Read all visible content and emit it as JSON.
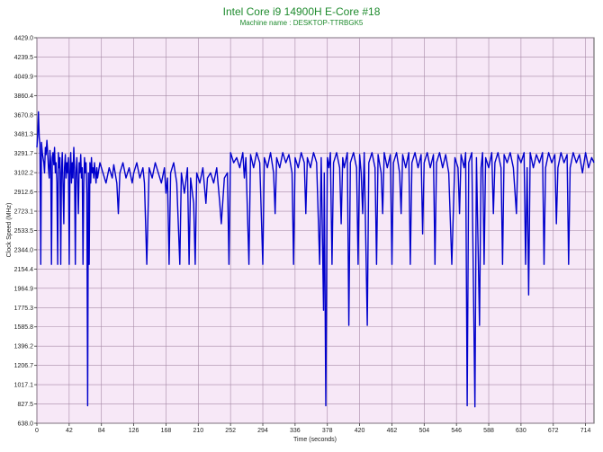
{
  "chart_data": {
    "type": "line",
    "title": "Intel Core i9 14900H E-Core #18",
    "subtitle": "Machine name : DESKTOP-TTRBGK5",
    "xlabel": "Time (seconds)",
    "ylabel": "Clock Speed (MHz)",
    "xlim": [
      0,
      725
    ],
    "ylim": [
      638.0,
      4429.0
    ],
    "x_ticks": [
      0,
      42,
      84,
      126,
      168,
      210,
      252,
      294,
      336,
      378,
      420,
      462,
      504,
      546,
      588,
      630,
      672,
      714
    ],
    "y_ticks": [
      638.0,
      827.5,
      1017.1,
      1206.7,
      1396.2,
      1585.8,
      1775.3,
      1964.9,
      2154.4,
      2344.0,
      2533.5,
      2723.1,
      2912.6,
      3102.2,
      3291.7,
      3481.3,
      3670.8,
      3860.4,
      4049.9,
      4239.5,
      4429.0
    ],
    "grid": true,
    "colors": {
      "plot_background": "#f7e8f7",
      "grid": "#a78aa7",
      "series": "#0000cc",
      "title": "#1f8b2e"
    },
    "series": [
      {
        "points": [
          [
            0,
            3350
          ],
          [
            1,
            3480
          ],
          [
            2,
            3700
          ],
          [
            3,
            3450
          ],
          [
            4,
            3380
          ],
          [
            5,
            2200
          ],
          [
            6,
            3400
          ],
          [
            7,
            3300
          ],
          [
            8,
            3250
          ],
          [
            9,
            3200
          ],
          [
            10,
            3100
          ],
          [
            11,
            3350
          ],
          [
            12,
            3280
          ],
          [
            13,
            3420
          ],
          [
            14,
            3300
          ],
          [
            15,
            3150
          ],
          [
            16,
            3050
          ],
          [
            17,
            3320
          ],
          [
            18,
            3200
          ],
          [
            19,
            2200
          ],
          [
            20,
            3250
          ],
          [
            21,
            3300
          ],
          [
            22,
            3180
          ],
          [
            23,
            3350
          ],
          [
            24,
            3100
          ],
          [
            25,
            3200
          ],
          [
            26,
            3000
          ],
          [
            27,
            2200
          ],
          [
            28,
            3300
          ],
          [
            29,
            3150
          ],
          [
            30,
            3250
          ],
          [
            31,
            2200
          ],
          [
            32,
            3100
          ],
          [
            33,
            3300
          ],
          [
            34,
            3000
          ],
          [
            35,
            2600
          ],
          [
            36,
            3150
          ],
          [
            37,
            3280
          ],
          [
            38,
            3050
          ],
          [
            39,
            3200
          ],
          [
            40,
            3100
          ],
          [
            41,
            3250
          ],
          [
            42,
            2200
          ],
          [
            43,
            3100
          ],
          [
            44,
            3300
          ],
          [
            45,
            3000
          ],
          [
            46,
            3200
          ],
          [
            47,
            3050
          ],
          [
            48,
            3350
          ],
          [
            49,
            3150
          ],
          [
            50,
            2200
          ],
          [
            51,
            3100
          ],
          [
            52,
            3250
          ],
          [
            53,
            3000
          ],
          [
            54,
            2700
          ],
          [
            55,
            3200
          ],
          [
            56,
            3100
          ],
          [
            57,
            3280
          ],
          [
            58,
            3050
          ],
          [
            59,
            3150
          ],
          [
            60,
            2200
          ],
          [
            61,
            3000
          ],
          [
            62,
            3250
          ],
          [
            63,
            3100
          ],
          [
            64,
            3200
          ],
          [
            65,
            2900
          ],
          [
            66,
            810
          ],
          [
            67,
            3100
          ],
          [
            68,
            2200
          ],
          [
            69,
            3200
          ],
          [
            70,
            3000
          ],
          [
            71,
            3250
          ],
          [
            72,
            3100
          ],
          [
            73,
            3150
          ],
          [
            74,
            3050
          ],
          [
            75,
            3200
          ],
          [
            76,
            3100
          ],
          [
            77,
            3000
          ],
          [
            78,
            3150
          ],
          [
            79,
            3050
          ],
          [
            82,
            3200
          ],
          [
            86,
            3100
          ],
          [
            90,
            3000
          ],
          [
            94,
            3150
          ],
          [
            98,
            3050
          ],
          [
            100,
            3180
          ],
          [
            104,
            3000
          ],
          [
            106,
            2700
          ],
          [
            108,
            3100
          ],
          [
            112,
            3200
          ],
          [
            116,
            3050
          ],
          [
            120,
            3150
          ],
          [
            124,
            3000
          ],
          [
            126,
            3100
          ],
          [
            130,
            3200
          ],
          [
            134,
            3050
          ],
          [
            138,
            3150
          ],
          [
            140,
            3000
          ],
          [
            143,
            2200
          ],
          [
            146,
            3150
          ],
          [
            150,
            3050
          ],
          [
            154,
            3200
          ],
          [
            158,
            3100
          ],
          [
            162,
            3000
          ],
          [
            166,
            3150
          ],
          [
            168,
            2900
          ],
          [
            170,
            3050
          ],
          [
            172,
            2200
          ],
          [
            174,
            3100
          ],
          [
            178,
            3200
          ],
          [
            182,
            3000
          ],
          [
            186,
            2200
          ],
          [
            188,
            3100
          ],
          [
            192,
            2900
          ],
          [
            196,
            3150
          ],
          [
            198,
            2200
          ],
          [
            200,
            3050
          ],
          [
            204,
            2800
          ],
          [
            206,
            2200
          ],
          [
            208,
            3100
          ],
          [
            212,
            3000
          ],
          [
            216,
            3150
          ],
          [
            220,
            2800
          ],
          [
            222,
            3050
          ],
          [
            226,
            3100
          ],
          [
            230,
            3000
          ],
          [
            234,
            3150
          ],
          [
            238,
            2800
          ],
          [
            240,
            2600
          ],
          [
            244,
            3050
          ],
          [
            248,
            3100
          ],
          [
            250,
            2200
          ],
          [
            252,
            3300
          ],
          [
            256,
            3200
          ],
          [
            260,
            3250
          ],
          [
            264,
            3150
          ],
          [
            268,
            3300
          ],
          [
            270,
            3050
          ],
          [
            272,
            3250
          ],
          [
            276,
            2200
          ],
          [
            278,
            3280
          ],
          [
            282,
            3150
          ],
          [
            286,
            3300
          ],
          [
            290,
            3200
          ],
          [
            294,
            2200
          ],
          [
            296,
            3250
          ],
          [
            300,
            3150
          ],
          [
            304,
            3300
          ],
          [
            308,
            3100
          ],
          [
            310,
            2700
          ],
          [
            312,
            3250
          ],
          [
            316,
            3150
          ],
          [
            320,
            3300
          ],
          [
            324,
            3200
          ],
          [
            328,
            3280
          ],
          [
            332,
            3100
          ],
          [
            334,
            2200
          ],
          [
            336,
            3250
          ],
          [
            340,
            3150
          ],
          [
            344,
            3300
          ],
          [
            348,
            3200
          ],
          [
            350,
            2700
          ],
          [
            352,
            3250
          ],
          [
            356,
            3150
          ],
          [
            360,
            3300
          ],
          [
            364,
            3200
          ],
          [
            368,
            2200
          ],
          [
            370,
            3250
          ],
          [
            373,
            1750
          ],
          [
            374,
            3100
          ],
          [
            376,
            810
          ],
          [
            378,
            3250
          ],
          [
            380,
            3150
          ],
          [
            382,
            3300
          ],
          [
            384,
            2200
          ],
          [
            386,
            3200
          ],
          [
            390,
            3300
          ],
          [
            394,
            3150
          ],
          [
            396,
            2600
          ],
          [
            398,
            3250
          ],
          [
            400,
            3150
          ],
          [
            404,
            3300
          ],
          [
            406,
            1600
          ],
          [
            408,
            3200
          ],
          [
            412,
            3300
          ],
          [
            416,
            3150
          ],
          [
            418,
            2200
          ],
          [
            420,
            3280
          ],
          [
            422,
            3100
          ],
          [
            424,
            2700
          ],
          [
            426,
            3300
          ],
          [
            430,
            1600
          ],
          [
            432,
            3200
          ],
          [
            436,
            3300
          ],
          [
            440,
            3150
          ],
          [
            442,
            2200
          ],
          [
            444,
            3280
          ],
          [
            448,
            3100
          ],
          [
            450,
            2700
          ],
          [
            452,
            3300
          ],
          [
            456,
            3150
          ],
          [
            460,
            3280
          ],
          [
            462,
            2200
          ],
          [
            464,
            3200
          ],
          [
            468,
            3300
          ],
          [
            472,
            3100
          ],
          [
            474,
            2700
          ],
          [
            476,
            3280
          ],
          [
            480,
            3150
          ],
          [
            484,
            3300
          ],
          [
            486,
            2200
          ],
          [
            488,
            3200
          ],
          [
            492,
            3300
          ],
          [
            496,
            3150
          ],
          [
            500,
            3280
          ],
          [
            502,
            2500
          ],
          [
            504,
            3200
          ],
          [
            508,
            3300
          ],
          [
            512,
            3150
          ],
          [
            516,
            3280
          ],
          [
            518,
            2200
          ],
          [
            520,
            3200
          ],
          [
            524,
            3300
          ],
          [
            528,
            3150
          ],
          [
            532,
            3280
          ],
          [
            536,
            3100
          ],
          [
            540,
            2200
          ],
          [
            544,
            3250
          ],
          [
            548,
            3150
          ],
          [
            550,
            2700
          ],
          [
            552,
            3280
          ],
          [
            556,
            3150
          ],
          [
            558,
            3300
          ],
          [
            560,
            810
          ],
          [
            562,
            3200
          ],
          [
            566,
            3300
          ],
          [
            570,
            800
          ],
          [
            572,
            3250
          ],
          [
            576,
            1600
          ],
          [
            578,
            3150
          ],
          [
            580,
            3300
          ],
          [
            582,
            2200
          ],
          [
            584,
            3250
          ],
          [
            588,
            3150
          ],
          [
            592,
            3300
          ],
          [
            594,
            2700
          ],
          [
            596,
            3200
          ],
          [
            600,
            3300
          ],
          [
            604,
            3150
          ],
          [
            606,
            2200
          ],
          [
            608,
            3280
          ],
          [
            612,
            3200
          ],
          [
            616,
            3300
          ],
          [
            620,
            3150
          ],
          [
            624,
            2700
          ],
          [
            626,
            3280
          ],
          [
            630,
            3200
          ],
          [
            634,
            3300
          ],
          [
            636,
            2200
          ],
          [
            638,
            3150
          ],
          [
            640,
            1900
          ],
          [
            642,
            3300
          ],
          [
            646,
            3150
          ],
          [
            650,
            3280
          ],
          [
            654,
            3200
          ],
          [
            658,
            3300
          ],
          [
            660,
            2200
          ],
          [
            662,
            3150
          ],
          [
            666,
            3300
          ],
          [
            670,
            3200
          ],
          [
            674,
            3280
          ],
          [
            676,
            2600
          ],
          [
            678,
            3150
          ],
          [
            682,
            3300
          ],
          [
            686,
            3200
          ],
          [
            690,
            3280
          ],
          [
            692,
            2200
          ],
          [
            694,
            3150
          ],
          [
            698,
            3300
          ],
          [
            702,
            3200
          ],
          [
            706,
            3280
          ],
          [
            710,
            3100
          ],
          [
            714,
            3300
          ],
          [
            718,
            3150
          ],
          [
            722,
            3250
          ],
          [
            725,
            3200
          ]
        ]
      }
    ]
  }
}
